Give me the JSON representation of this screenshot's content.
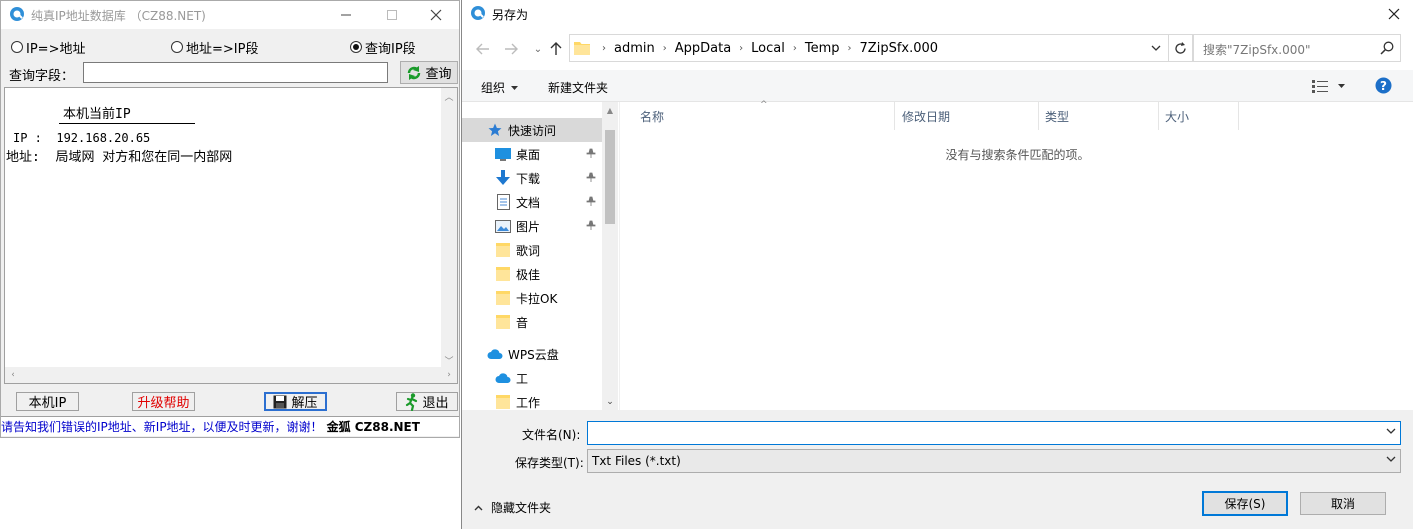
{
  "qqwry": {
    "title": "纯真IP地址数据库 （CZ88.NET)",
    "radios": [
      {
        "label": "IP=>地址",
        "checked": false
      },
      {
        "label": "地址=>IP段",
        "checked": false
      },
      {
        "label": "查询IP段",
        "checked": true
      }
    ],
    "query_label": "查询字段：",
    "query_value": "",
    "query_button": "查询",
    "result": {
      "heading": "本机当前IP",
      "ip_line": "IP :  192.168.20.65",
      "addr_line": "地址:  局域网 对方和您在同一内部网"
    },
    "buttons": {
      "local_ip": "本机IP",
      "upgrade_help": "升级帮助",
      "extract": "解压",
      "exit": "退出"
    },
    "status": {
      "message": "请告知我们错误的IP地址、新IP地址，以便及时更新，谢谢！",
      "brand": "金狐 CZ88.NET"
    },
    "colors": {
      "upgrade": "#e00000",
      "status_text": "#0000cc"
    }
  },
  "saveas": {
    "title": "另存为",
    "breadcrumbs": [
      "admin",
      "AppData",
      "Local",
      "Temp",
      "7ZipSfx.000"
    ],
    "search_placeholder": "搜索\"7ZipSfx.000\"",
    "toolbar": {
      "organize": "组织",
      "new_folder": "新建文件夹"
    },
    "nav": [
      {
        "label": "快速访问",
        "icon": "star-icon",
        "pinned": false
      },
      {
        "label": "桌面",
        "icon": "desktop-icon",
        "pinned": true
      },
      {
        "label": "下载",
        "icon": "download-icon",
        "pinned": true
      },
      {
        "label": "文档",
        "icon": "document-icon",
        "pinned": true
      },
      {
        "label": "图片",
        "icon": "picture-icon",
        "pinned": true
      },
      {
        "label": "歌词",
        "icon": "folder-icon",
        "pinned": false
      },
      {
        "label": "极佳",
        "icon": "folder-icon",
        "pinned": false
      },
      {
        "label": "卡拉OK",
        "icon": "folder-icon",
        "pinned": false
      },
      {
        "label": "音",
        "icon": "folder-icon",
        "pinned": false
      },
      {
        "label": "WPS云盘",
        "icon": "cloud-icon",
        "pinned": false
      },
      {
        "label": "工",
        "icon": "cloud-icon",
        "pinned": false
      },
      {
        "label": "工作",
        "icon": "folder-icon",
        "pinned": false
      }
    ],
    "columns": [
      "名称",
      "修改日期",
      "类型",
      "大小"
    ],
    "empty_message": "没有与搜索条件匹配的项。",
    "filename_label": "文件名(N):",
    "filename_value": "",
    "filetype_label": "保存类型(T):",
    "filetype_value": "Txt Files (*.txt)",
    "hide_folders": "隐藏文件夹",
    "save_button": "保存(S)",
    "cancel_button": "取消"
  }
}
